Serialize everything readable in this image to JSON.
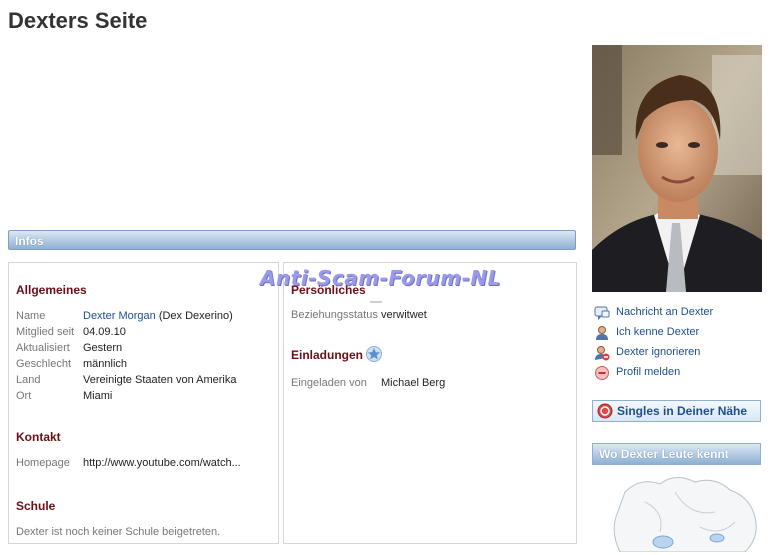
{
  "page": {
    "title": "Dexters Seite"
  },
  "infos_bar": "Infos",
  "watermark": "Anti-Scam-Forum-NL",
  "allgemeines": {
    "heading": "Allgemeines",
    "rows": [
      {
        "label": "Name",
        "value_link": "Dexter Morgan",
        "value_extra": "(Dex Dexerino)"
      },
      {
        "label": "Mitglied seit",
        "value": "04.09.10"
      },
      {
        "label": "Aktualisiert",
        "value": "Gestern"
      },
      {
        "label": "Geschlecht",
        "value_link": "männlich"
      },
      {
        "label": "Land",
        "value": "Vereinigte Staaten von Amerika"
      },
      {
        "label": "Ort",
        "value_link": "Miami"
      }
    ]
  },
  "kontakt": {
    "heading": "Kontakt",
    "homepage_label": "Homepage",
    "homepage_value": "http://www.youtube.com/watch..."
  },
  "schule": {
    "heading": "Schule",
    "text": "Dexter ist noch keiner Schule beigetreten."
  },
  "persoenliches": {
    "heading": "Persönliches",
    "status_label": "Beziehungsstatus",
    "status_value": "verwitwet"
  },
  "einladungen": {
    "heading": "Einladungen",
    "label": "Eingeladen von",
    "value": "Michael Berg"
  },
  "actions": [
    {
      "label": "Nachricht an Dexter",
      "icon": "message-icon"
    },
    {
      "label": "Ich kenne Dexter",
      "icon": "user-icon"
    },
    {
      "label": "Dexter ignorieren",
      "icon": "user-block-icon"
    },
    {
      "label": "Profil melden",
      "icon": "report-icon"
    }
  ],
  "singles_box": "Singles in Deiner Nähe",
  "map_box": "Wo Dexter Leute kennt",
  "colors": {
    "section_title": "#6b0f16",
    "link": "#1d4f8c",
    "bar": "#8fb0d2"
  }
}
